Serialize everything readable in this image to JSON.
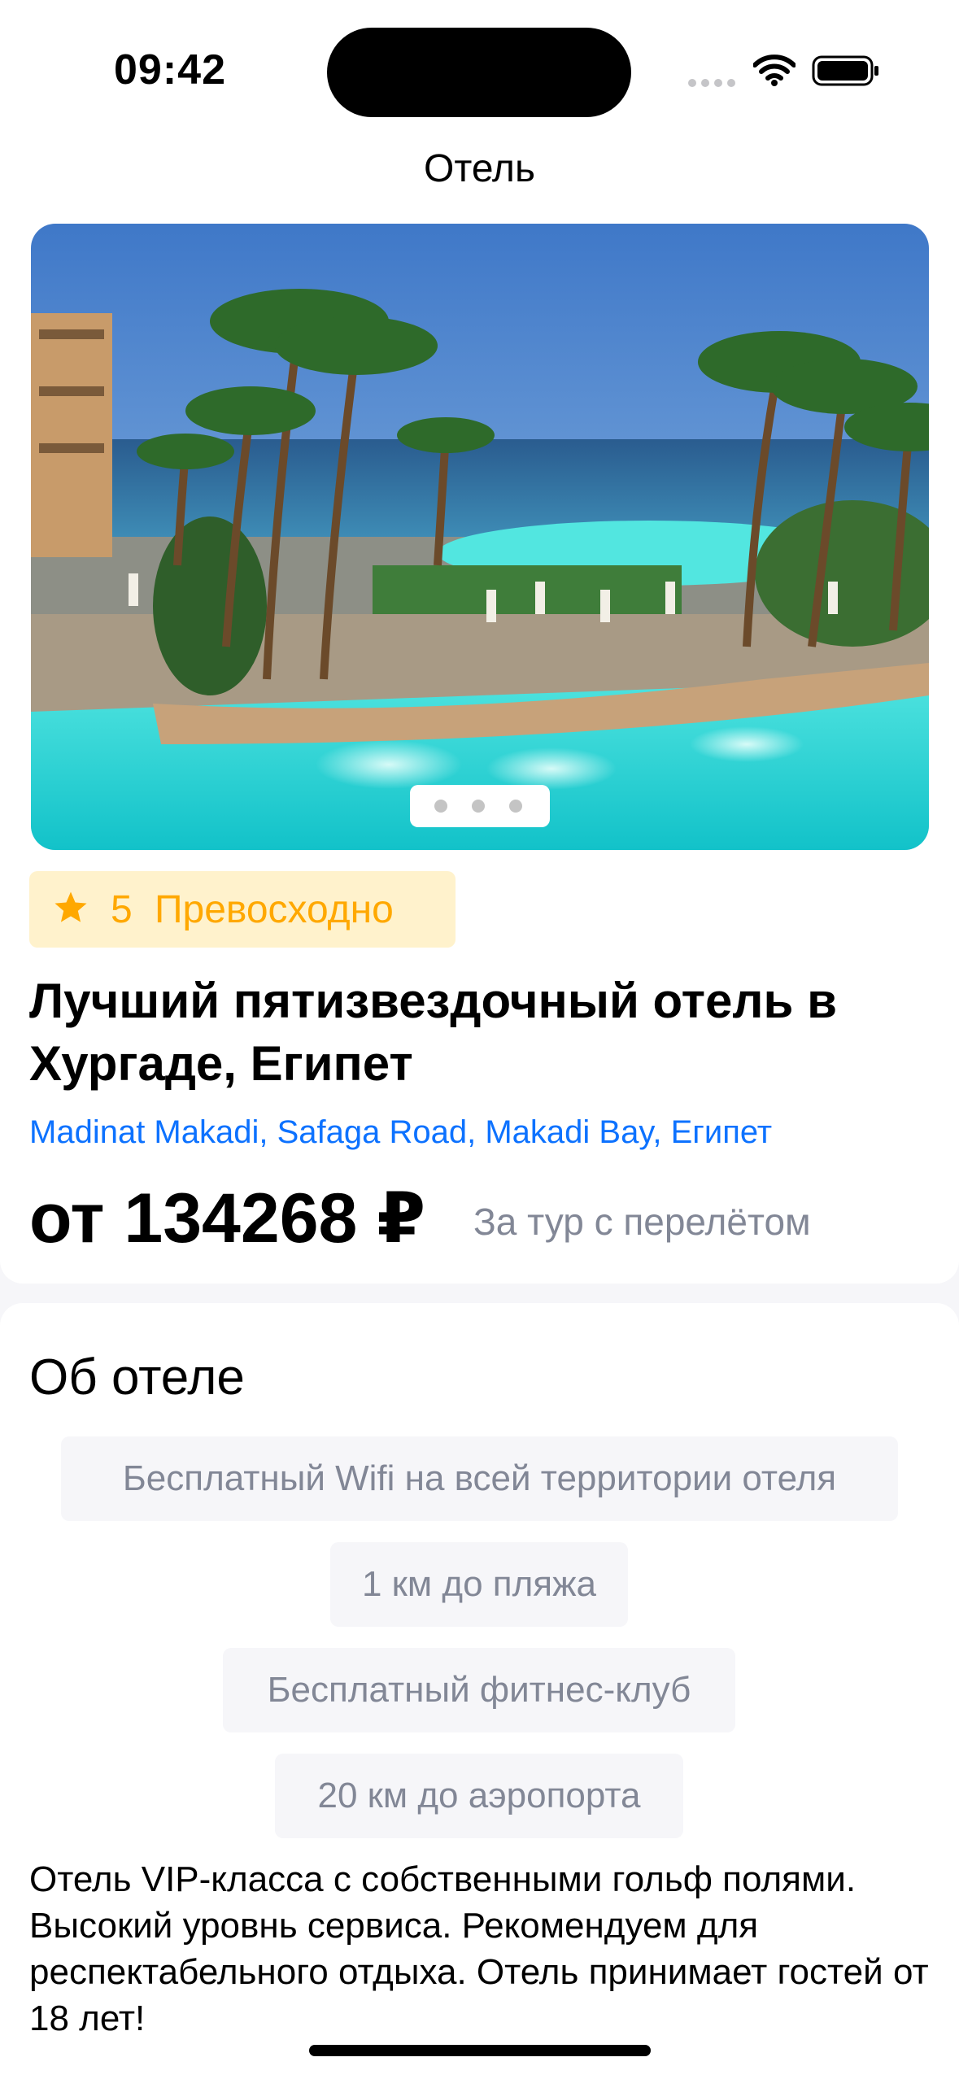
{
  "status_bar": {
    "time": "09:42",
    "icons": [
      "cellular-signal-icon",
      "wifi-icon",
      "battery-icon"
    ]
  },
  "nav": {
    "title": "Отель"
  },
  "carousel": {
    "image": "hotel-pool-photo",
    "pages": 3,
    "current_page": 1
  },
  "rating": {
    "icon": "star-icon",
    "value": "5",
    "label": "Превосходно"
  },
  "hotel": {
    "name": "Лучший пятизвездочный отель в Хургаде, Египет",
    "address": "Madinat Makadi, Safaga Road, Makadi Bay, Египет",
    "price": "от 134268 ₽",
    "price_note": "За тур с перелётом"
  },
  "about": {
    "title": "Об отеле",
    "chips": [
      "Бесплатный Wifi на всей территории отеля",
      "1 км до пляжа",
      "Бесплатный фитнес-клуб",
      "20 км до аэропорта"
    ],
    "description": "Отель VIP-класса с собственными гольф полями. Высокий уровнь сервиса. Рекомендуем для респектабельного отдыха. Отель принимает гостей от 18 лет!"
  },
  "colors": {
    "accent_blue": "#0d72ff",
    "rating_text": "#ffa800",
    "rating_bg": "#fff2cc",
    "muted_text": "#828796",
    "chip_bg": "#f6f6f9",
    "page_bg": "#f6f6f9"
  }
}
